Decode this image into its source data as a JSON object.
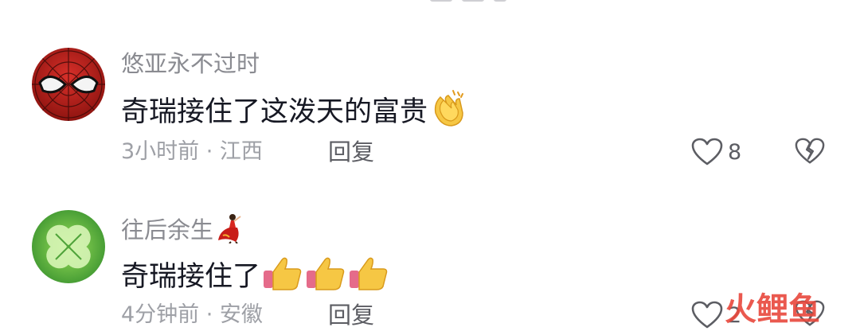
{
  "comments": [
    {
      "username": "悠亚永不过时",
      "text": "奇瑞接住了这泼天的富贵",
      "emoji": "clapping-hands-icon",
      "meta": "3小时前 · 江西",
      "reply_label": "回复",
      "likes": "8",
      "avatar": "spider-mask-avatar"
    },
    {
      "username": "往后余生",
      "username_badge": "flamenco-dancer-icon",
      "text": "奇瑞接住了",
      "emoji": "thumbs-up-icon",
      "meta": "4分钟前 · 安徽",
      "reply_label": "回复",
      "likes": "2",
      "avatar": "clover-avatar"
    }
  ],
  "watermark": "火鲤鱼",
  "colors": {
    "username": "#8a8b91",
    "text": "#161823",
    "meta": "#9ea0a6",
    "watermark": "#e8483c"
  }
}
